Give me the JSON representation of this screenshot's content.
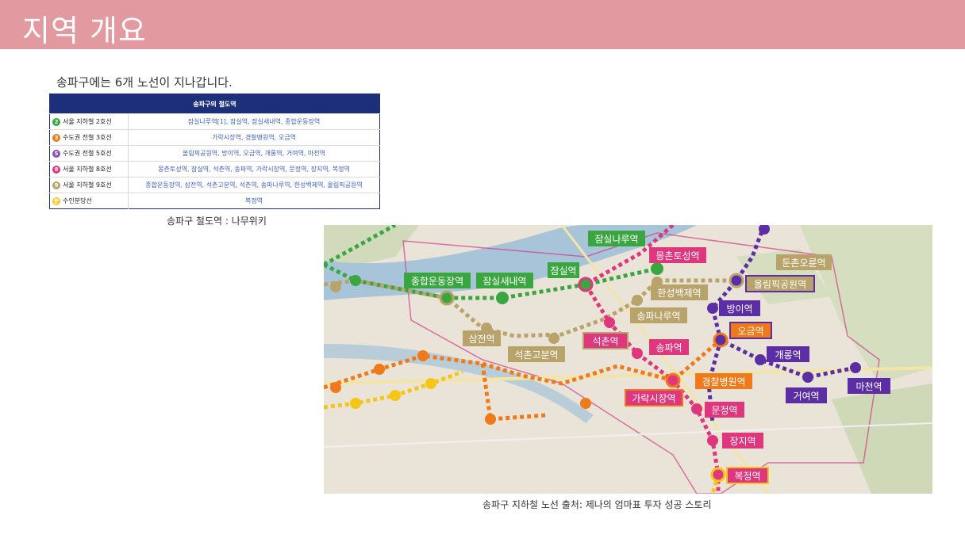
{
  "title": "지역 개요",
  "intro": "송파구에는 6개 노선이 지나갑니다.",
  "table": {
    "header": "송파구의 철도역",
    "rows": [
      {
        "num": "2",
        "color": "#3aa640",
        "line": "서울 지하철 2호선",
        "stations": "잠실나루역[1], 잠실역, 잠실새내역, 종합운동장역"
      },
      {
        "num": "3",
        "color": "#f07a1a",
        "line": "수도권 전철 3호선",
        "stations": "가락시장역, 경찰병원역, 오금역"
      },
      {
        "num": "5",
        "color": "#8a4fb5",
        "line": "수도권 전철 5호선",
        "stations": "올림픽공원역, 방이역, 오금역, 개롱역, 거여역, 마천역"
      },
      {
        "num": "8",
        "color": "#e0367d",
        "line": "서울 지하철 8호선",
        "stations": "몽촌토성역, 잠실역, 석촌역, 송파역, 가락시장역, 문정역, 장지역, 복정역"
      },
      {
        "num": "9",
        "color": "#b8a36a",
        "line": "서울 지하철 9호선",
        "stations": "종합운동장역, 삼전역, 석촌고분역, 석촌역, 송파나루역, 한성백제역, 올림픽공원역"
      },
      {
        "num": "분",
        "color": "#f5c518",
        "line": "수인분당선",
        "stations": "복정역"
      }
    ]
  },
  "caption1": "송파구 철도역 : 나무위키",
  "caption2": "송파구 지하철 노선 출처: 제나의 엄마표 투자 성공 스토리",
  "map": {
    "labels": {
      "jamsilnaru": "잠실나루역",
      "mongchon": "몽촌토성역",
      "dunchon": "둔촌오륜역",
      "sports": "종합운동장역",
      "jamsilsaenae": "잠실새내역",
      "jamsil": "잠실역",
      "olympic": "올림픽공원역",
      "hanseong": "한성백제역",
      "bangi": "방이역",
      "songpanaru": "송파나루역",
      "ogeum": "오금역",
      "samjeon": "삼전역",
      "seokchon": "석촌역",
      "songpa": "송파역",
      "seokchongobun": "석촌고분역",
      "gaerong": "개롱역",
      "police": "경찰병원역",
      "macheon": "마천역",
      "garak": "가락시장역",
      "geoyeo": "거여역",
      "munjeong": "문정역",
      "jangji": "장지역",
      "bokjeong": "복정역"
    }
  }
}
